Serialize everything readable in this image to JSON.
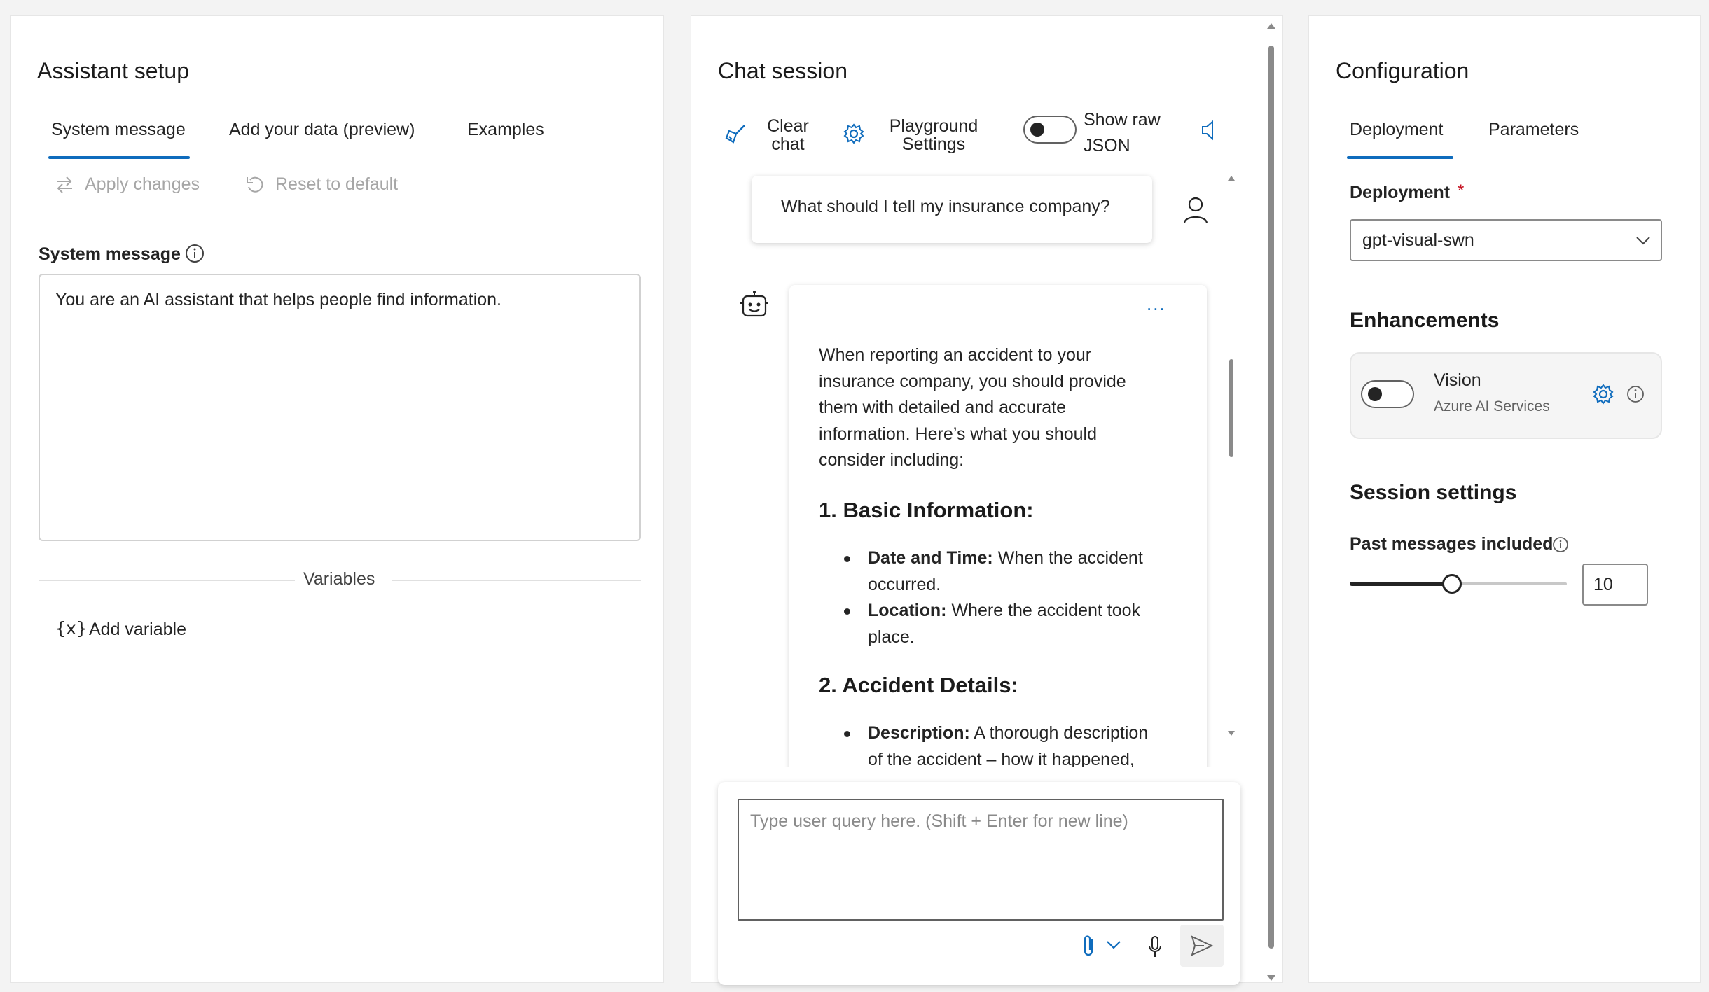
{
  "assistant_setup": {
    "title": "Assistant setup",
    "tabs": [
      "System message",
      "Add your data (preview)",
      "Examples"
    ],
    "apply_label": "Apply changes",
    "reset_label": "Reset to default",
    "system_message_label": "System message",
    "system_message_value": "You are an AI assistant that helps people find information.",
    "variables_label": "Variables",
    "add_variable_label": "Add variable",
    "variable_icon_text": "{x}"
  },
  "chat_session": {
    "title": "Chat session",
    "clear_chat_label_line1": "Clear",
    "clear_chat_label_line2": "chat",
    "playground_label_line1": "Playground",
    "playground_label_line2": "Settings",
    "raw_json_label_line1": "Show raw",
    "raw_json_label_line2": "JSON",
    "user_message": "What should I tell my insurance company?",
    "more_options": "...",
    "bot_intro_lines": [
      "When reporting an accident to your",
      "insurance company, you should provide",
      "them with detailed and accurate",
      "information. Here’s what you should",
      "consider including:"
    ],
    "heading_1": "1. Basic Information:",
    "bullet_1_bold": "Date and Time:",
    "bullet_1_line1": " When the accident",
    "bullet_1_line2": "occurred.",
    "bullet_2_bold": "Location:",
    "bullet_2_line1": " Where the accident took",
    "bullet_2_line2": "place.",
    "heading_2": "2. Accident Details:",
    "bullet_3_bold": "Description:",
    "bullet_3_line1": " A thorough description",
    "bullet_3_line2": "of the accident – how it happened,",
    "input_placeholder": "Type user query here. (Shift + Enter for new line)",
    "raw_json_toggle_on": false
  },
  "configuration": {
    "title": "Configuration",
    "tabs": [
      "Deployment",
      "Parameters"
    ],
    "deployment_label": "Deployment",
    "required_mark": "*",
    "deployment_value": "gpt-visual-swn",
    "enhancements_title": "Enhancements",
    "vision_label": "Vision",
    "vision_sub": "Azure AI Services",
    "vision_enabled": false,
    "session_settings_title": "Session settings",
    "past_messages_label": "Past messages included",
    "past_messages_value": "10",
    "past_messages_slider_fraction": 0.47
  },
  "colors": {
    "accent": "#0f6cbd",
    "required": "#c50f1f",
    "muted": "#a6a6a6"
  },
  "icons": [
    "swap-arrows-icon",
    "undo-icon",
    "info-icon",
    "broom-icon",
    "gear-icon",
    "speaker-icon",
    "user-icon",
    "bot-icon",
    "more-icon",
    "paperclip-icon",
    "chevron-down-icon",
    "microphone-icon",
    "send-icon"
  ]
}
